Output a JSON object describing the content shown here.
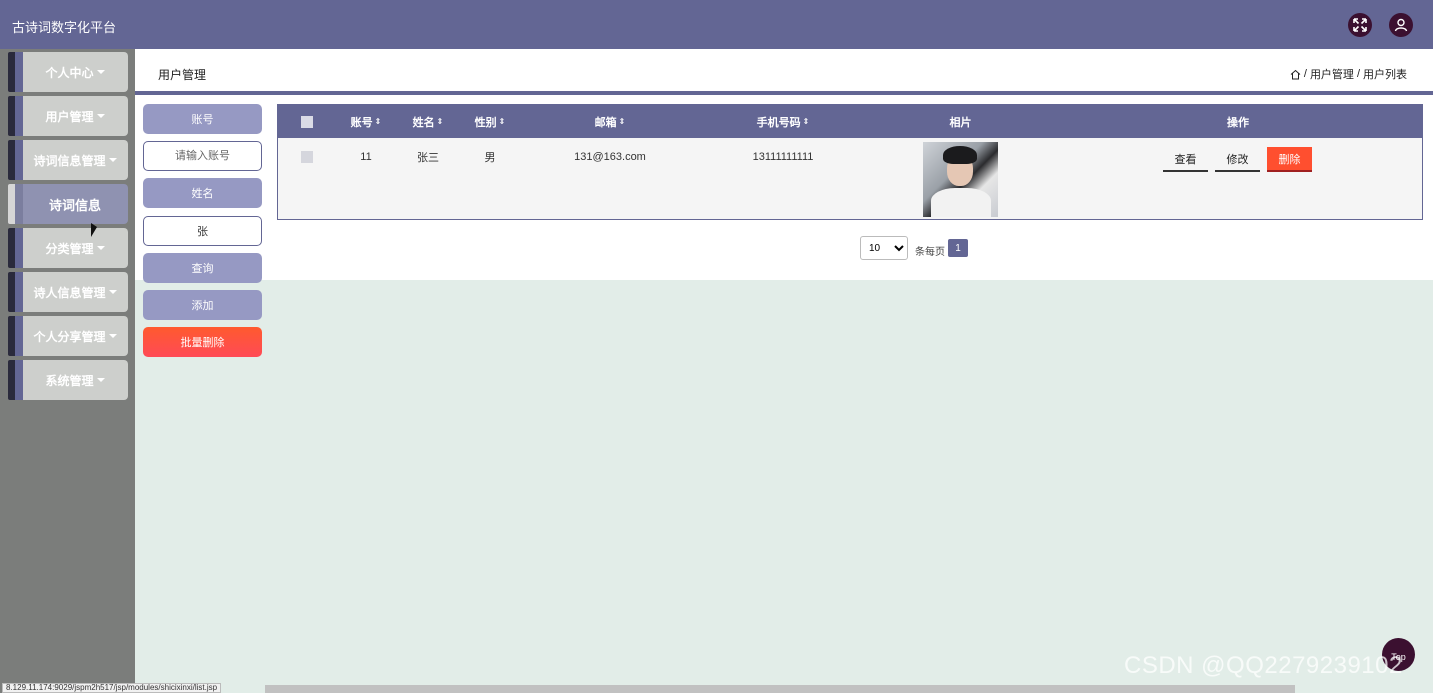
{
  "header": {
    "title": "古诗词数字化平台",
    "fullscreen_icon": "expand-arrows-icon",
    "user_icon": "user-icon"
  },
  "sidebar": {
    "items": [
      {
        "label": "个人中心",
        "has_caret": true
      },
      {
        "label": "用户管理",
        "has_caret": true
      },
      {
        "label": "诗词信息管理",
        "has_caret": true
      },
      {
        "label": "诗词信息",
        "has_caret": false,
        "active": true
      },
      {
        "label": "分类管理",
        "has_caret": true
      },
      {
        "label": "诗人信息管理",
        "has_caret": true
      },
      {
        "label": "个人分享管理",
        "has_caret": true
      },
      {
        "label": "系统管理",
        "has_caret": true
      }
    ]
  },
  "content_header": {
    "title": "用户管理",
    "breadcrumb": [
      "用户管理",
      "用户列表"
    ],
    "separator": "/"
  },
  "search": {
    "account_label": "账号",
    "account_placeholder": "请输入账号",
    "name_label": "姓名",
    "name_value": "张",
    "query_label": "查询",
    "add_label": "添加",
    "batch_delete_label": "批量删除"
  },
  "table": {
    "columns": [
      "账号",
      "姓名",
      "性别",
      "邮箱",
      "手机号码",
      "相片",
      "操作"
    ],
    "rows": [
      {
        "account": "11",
        "name": "张三",
        "gender": "男",
        "email": "131@163.com",
        "phone": "13111111111"
      }
    ],
    "actions": {
      "view": "查看",
      "edit": "修改",
      "delete": "删除"
    }
  },
  "pagination": {
    "page_size": "10",
    "page_size_options": [
      "10"
    ],
    "per_page_label": "条每页",
    "current_page": "1"
  },
  "misc": {
    "top_button": "Top",
    "status_url": "8.129.11.174:9029/jspm2h517/jsp/modules/shicixinxi/list.jsp",
    "watermark": "CSDN @QQ2279239102"
  },
  "colors": {
    "primary": "#636694",
    "sidebar_bg": "#7b7d7b",
    "content_bg": "#e2ede8",
    "danger": "#ff4f2f"
  }
}
